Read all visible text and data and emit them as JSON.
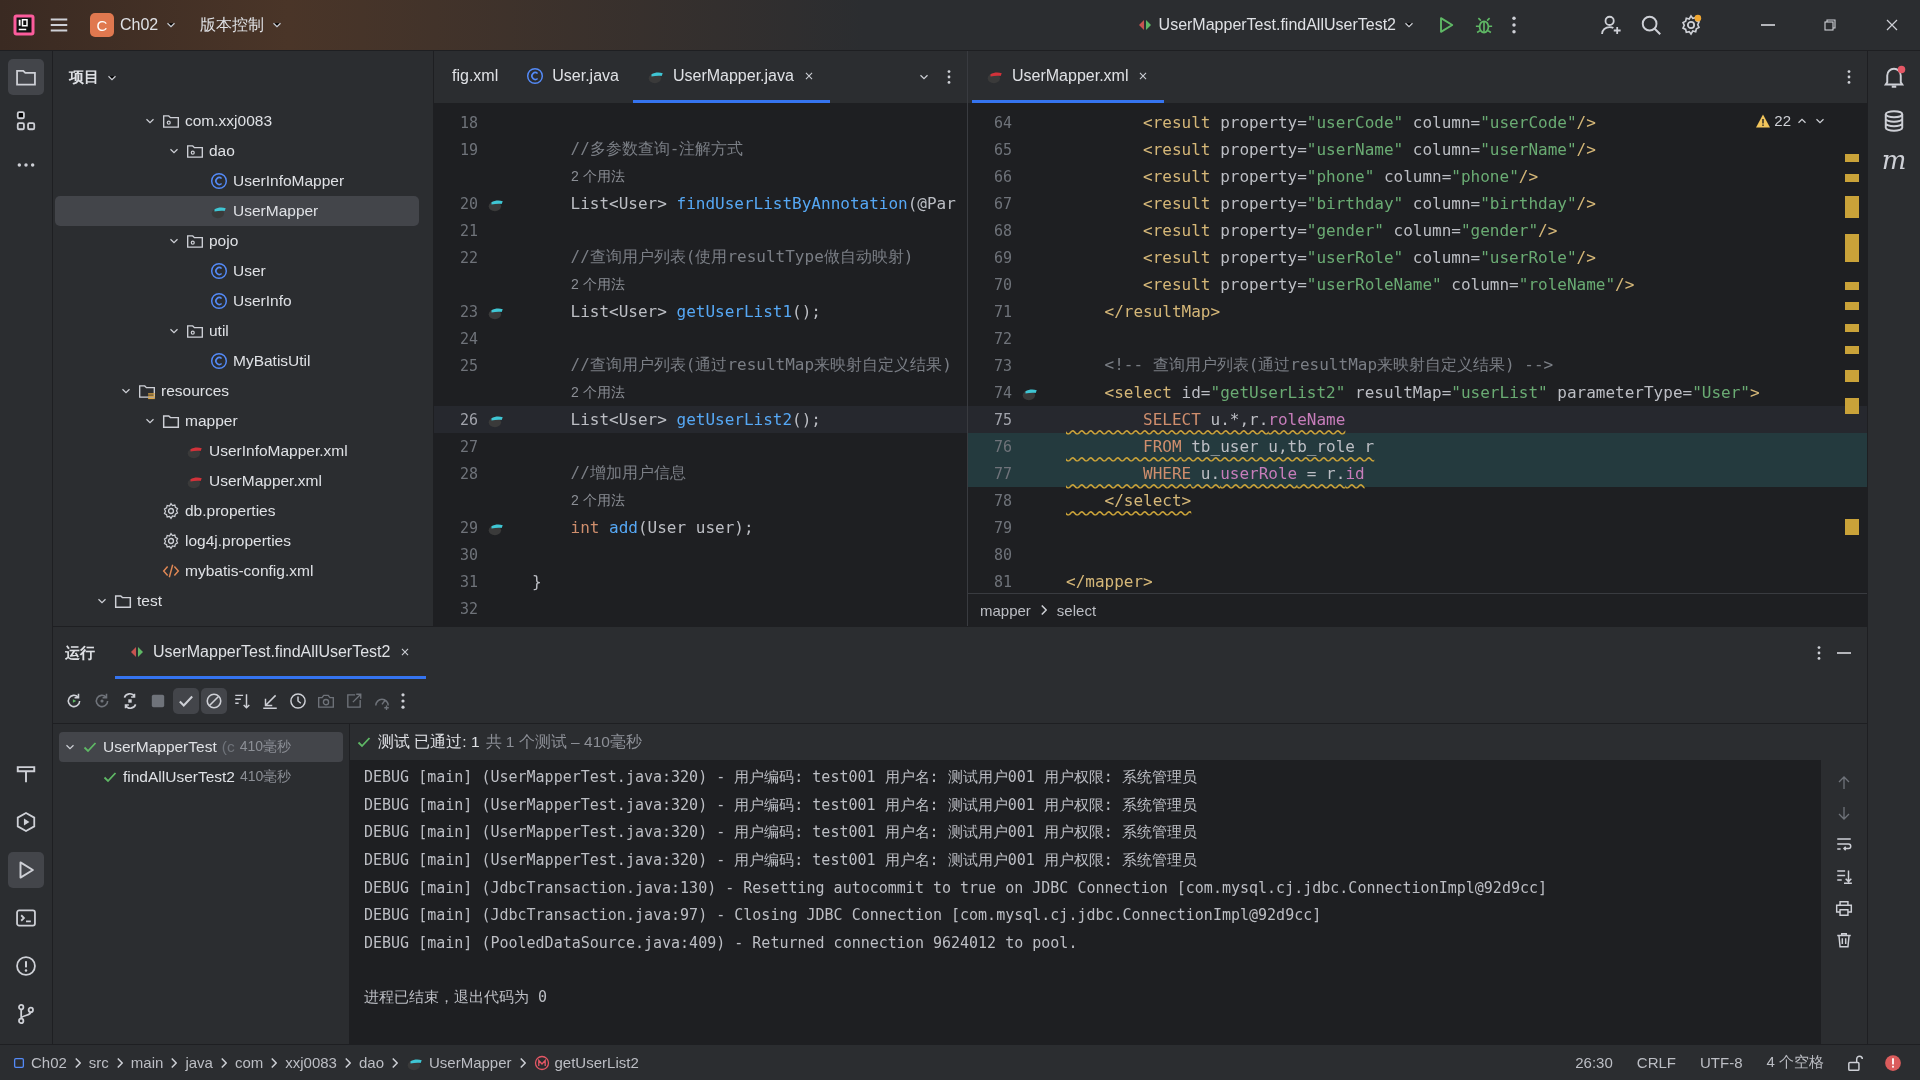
{
  "title_bar": {
    "project": {
      "badge": "C",
      "name": "Ch02"
    },
    "vcs": "版本控制",
    "run_config": "UserMapperTest.findAllUserTest2"
  },
  "left_toolbar": {
    "top": [
      {
        "kind": "folder",
        "selected": true
      },
      {
        "kind": "structure",
        "selected": false
      },
      {
        "kind": "more",
        "selected": false
      }
    ],
    "bottom": [
      {
        "kind": "hammer",
        "selected": false
      },
      {
        "kind": "services",
        "selected": false
      },
      {
        "kind": "run",
        "selected": true
      },
      {
        "kind": "terminal",
        "selected": false
      },
      {
        "kind": "problems",
        "selected": false
      },
      {
        "kind": "git",
        "selected": false
      }
    ]
  },
  "right_toolbar": [
    {
      "kind": "notifications"
    },
    {
      "kind": "database"
    },
    {
      "kind": "maven",
      "glyph": "m"
    }
  ],
  "project_panel": {
    "title": "项目",
    "tree": [
      {
        "children": [
          {
            "children": [
              {
                "label": "com.xxj0083",
                "kind": "package",
                "expanded": true,
                "selected": false,
                "children": [
                  {
                    "label": "dao",
                    "kind": "package",
                    "expanded": true,
                    "selected": false,
                    "children": [
                      {
                        "label": "UserInfoMapper",
                        "kind": "class",
                        "selected": false
                      },
                      {
                        "label": "UserMapper",
                        "kind": "mapper",
                        "selected": true
                      }
                    ]
                  },
                  {
                    "label": "pojo",
                    "kind": "package",
                    "expanded": true,
                    "selected": false,
                    "children": [
                      {
                        "label": "User",
                        "kind": "class",
                        "selected": false
                      },
                      {
                        "label": "UserInfo",
                        "kind": "class",
                        "selected": false
                      }
                    ]
                  },
                  {
                    "label": "util",
                    "kind": "package",
                    "expanded": true,
                    "selected": false,
                    "children": [
                      {
                        "label": "MyBatisUtil",
                        "kind": "class",
                        "selected": false
                      }
                    ]
                  }
                ]
              }
            ]
          },
          {
            "label": "resources",
            "kind": "resources",
            "expanded": true,
            "selected": false,
            "children": [
              {
                "label": "mapper",
                "kind": "folder",
                "expanded": true,
                "selected": false,
                "children": [
                  {
                    "label": "UserInfoMapper.xml",
                    "kind": "mapper_xml",
                    "selected": false
                  },
                  {
                    "label": "UserMapper.xml",
                    "kind": "mapper_xml",
                    "selected": false
                  }
                ]
              },
              {
                "label": "db.properties",
                "kind": "properties",
                "selected": false
              },
              {
                "label": "log4j.properties",
                "kind": "properties",
                "selected": false
              },
              {
                "label": "mybatis-config.xml",
                "kind": "xml",
                "selected": false
              }
            ]
          }
        ]
      },
      {
        "label": "test",
        "kind": "folder",
        "expanded": true,
        "selected": false
      }
    ]
  },
  "left_editor": {
    "tabs": [
      {
        "label": "fig.xml",
        "kind": "plain",
        "selected": false
      },
      {
        "label": "User.java",
        "kind": "class",
        "selected": false
      },
      {
        "label": "UserMapper.java",
        "kind": "mapper",
        "selected": true,
        "closable": true
      }
    ],
    "lines": [
      {
        "kind": "code",
        "number": "18",
        "current": false,
        "marker": false
      },
      {
        "kind": "code",
        "number": "19",
        "current": false,
        "marker": false,
        "tokens": [
          {
            "kind": "comment",
            "text": "    //多参数查询-注解方式"
          }
        ]
      },
      {
        "kind": "hint",
        "text": "2 个用法"
      },
      {
        "kind": "code",
        "number": "20",
        "current": false,
        "marker": true,
        "tokens": [
          {
            "kind": "plain",
            "text": "    List<User> "
          },
          {
            "kind": "method",
            "text": "findUserListByAnnotation"
          },
          {
            "kind": "plain",
            "text": "(@Par"
          }
        ]
      },
      {
        "kind": "code",
        "number": "21",
        "current": false,
        "marker": false
      },
      {
        "kind": "code",
        "number": "22",
        "current": false,
        "marker": false,
        "tokens": [
          {
            "kind": "comment",
            "text": "    //查询用户列表(使用resultType做自动映射)"
          }
        ]
      },
      {
        "kind": "hint",
        "text": "2 个用法"
      },
      {
        "kind": "code",
        "number": "23",
        "current": false,
        "marker": true,
        "tokens": [
          {
            "kind": "plain",
            "text": "    List<User> "
          },
          {
            "kind": "method",
            "text": "getUserList1"
          },
          {
            "kind": "plain",
            "text": "();"
          }
        ]
      },
      {
        "kind": "code",
        "number": "24",
        "current": false,
        "marker": false
      },
      {
        "kind": "code",
        "number": "25",
        "current": false,
        "marker": false,
        "tokens": [
          {
            "kind": "comment",
            "text": "    //查询用户列表(通过resultMap来映射自定义结果)"
          }
        ]
      },
      {
        "kind": "hint",
        "text": "2 个用法"
      },
      {
        "kind": "code",
        "number": "26",
        "current": true,
        "marker": true,
        "tokens": [
          {
            "kind": "plain",
            "text": "    List<User> "
          },
          {
            "kind": "method",
            "text": "getUserList2"
          },
          {
            "kind": "plain",
            "text": "();"
          }
        ]
      },
      {
        "kind": "code",
        "number": "27",
        "current": false,
        "marker": false
      },
      {
        "kind": "code",
        "number": "28",
        "current": false,
        "marker": false,
        "tokens": [
          {
            "kind": "comment",
            "text": "    //增加用户信息"
          }
        ]
      },
      {
        "kind": "hint",
        "text": "2 个用法"
      },
      {
        "kind": "code",
        "number": "29",
        "current": false,
        "marker": true,
        "tokens": [
          {
            "kind": "keyword",
            "text": "    int "
          },
          {
            "kind": "method",
            "text": "add"
          },
          {
            "kind": "plain",
            "text": "(User user);"
          }
        ]
      },
      {
        "kind": "code",
        "number": "30",
        "current": false,
        "marker": false
      },
      {
        "kind": "code",
        "number": "31",
        "current": false,
        "marker": false,
        "tokens": [
          {
            "kind": "plain",
            "text": "}"
          }
        ]
      },
      {
        "kind": "code",
        "number": "32",
        "current": false,
        "marker": false
      }
    ]
  },
  "right_editor": {
    "tabs": [
      {
        "label": "UserMapper.xml",
        "kind": "mapper_xml",
        "selected": true,
        "closable": true
      }
    ],
    "warnings": "22",
    "lines": [
      {
        "number": "64",
        "current": false,
        "highlighted": false,
        "warning": false,
        "marker": false,
        "tokens": [
          {
            "kind": "tag",
            "text": "        <result"
          },
          {
            "kind": "attr",
            "text": " property="
          },
          {
            "kind": "string",
            "text": "\"userCode\""
          },
          {
            "kind": "attr",
            "text": " column="
          },
          {
            "kind": "string",
            "text": "\"userCode\""
          },
          {
            "kind": "tag",
            "text": "/>"
          }
        ]
      },
      {
        "number": "65",
        "current": false,
        "highlighted": false,
        "warning": false,
        "marker": false,
        "tokens": [
          {
            "kind": "tag",
            "text": "        <result"
          },
          {
            "kind": "attr",
            "text": " property="
          },
          {
            "kind": "string",
            "text": "\"userName\""
          },
          {
            "kind": "attr",
            "text": " column="
          },
          {
            "kind": "string",
            "text": "\"userName\""
          },
          {
            "kind": "tag",
            "text": "/>"
          }
        ]
      },
      {
        "number": "66",
        "current": false,
        "highlighted": false,
        "warning": false,
        "marker": false,
        "tokens": [
          {
            "kind": "tag",
            "text": "        <result"
          },
          {
            "kind": "attr",
            "text": " property="
          },
          {
            "kind": "string",
            "text": "\"phone\""
          },
          {
            "kind": "attr",
            "text": " column="
          },
          {
            "kind": "string",
            "text": "\"phone\""
          },
          {
            "kind": "tag",
            "text": "/>"
          }
        ]
      },
      {
        "number": "67",
        "current": false,
        "highlighted": false,
        "warning": false,
        "marker": false,
        "tokens": [
          {
            "kind": "tag",
            "text": "        <result"
          },
          {
            "kind": "attr",
            "text": " property="
          },
          {
            "kind": "string",
            "text": "\"birthday\""
          },
          {
            "kind": "attr",
            "text": " column="
          },
          {
            "kind": "string",
            "text": "\"birthday\""
          },
          {
            "kind": "tag",
            "text": "/>"
          }
        ]
      },
      {
        "number": "68",
        "current": false,
        "highlighted": false,
        "warning": false,
        "marker": false,
        "tokens": [
          {
            "kind": "tag",
            "text": "        <result"
          },
          {
            "kind": "attr",
            "text": " property="
          },
          {
            "kind": "string",
            "text": "\"gender\""
          },
          {
            "kind": "attr",
            "text": " column="
          },
          {
            "kind": "string",
            "text": "\"gender\""
          },
          {
            "kind": "tag",
            "text": "/>"
          }
        ]
      },
      {
        "number": "69",
        "current": false,
        "highlighted": false,
        "warning": false,
        "marker": false,
        "tokens": [
          {
            "kind": "tag",
            "text": "        <result"
          },
          {
            "kind": "attr",
            "text": " property="
          },
          {
            "kind": "string",
            "text": "\"userRole\""
          },
          {
            "kind": "attr",
            "text": " column="
          },
          {
            "kind": "string",
            "text": "\"userRole\""
          },
          {
            "kind": "tag",
            "text": "/>"
          }
        ]
      },
      {
        "number": "70",
        "current": false,
        "highlighted": false,
        "warning": false,
        "marker": false,
        "tokens": [
          {
            "kind": "tag",
            "text": "        <result"
          },
          {
            "kind": "attr",
            "text": " property="
          },
          {
            "kind": "string",
            "text": "\"userRoleName\""
          },
          {
            "kind": "attr",
            "text": " column="
          },
          {
            "kind": "string",
            "text": "\"roleName\""
          },
          {
            "kind": "tag",
            "text": "/>"
          }
        ]
      },
      {
        "number": "71",
        "current": false,
        "highlighted": false,
        "warning": false,
        "marker": false,
        "tokens": [
          {
            "kind": "tag",
            "text": "    </resultMap>"
          }
        ]
      },
      {
        "number": "72",
        "current": false,
        "highlighted": false,
        "marker": false
      },
      {
        "number": "73",
        "current": false,
        "highlighted": false,
        "warning": false,
        "marker": false,
        "tokens": [
          {
            "kind": "comment",
            "text": "    <!-- 查询用户列表(通过resultMap来映射自定义结果) -->"
          }
        ]
      },
      {
        "number": "74",
        "current": false,
        "highlighted": false,
        "warning": false,
        "marker": true,
        "tokens": [
          {
            "kind": "tag",
            "text": "    <select"
          },
          {
            "kind": "attr",
            "text": " id="
          },
          {
            "kind": "string",
            "text": "\"getUserList2\""
          },
          {
            "kind": "attr",
            "text": " resultMap="
          },
          {
            "kind": "string",
            "text": "\"userList\""
          },
          {
            "kind": "attr",
            "text": " parameterType="
          },
          {
            "kind": "string",
            "text": "\"User\""
          },
          {
            "kind": "tag",
            "text": ">"
          }
        ]
      },
      {
        "number": "75",
        "current": true,
        "highlighted": false,
        "warning": true,
        "marker": false,
        "tokens": [
          {
            "kind": "sql_keyword",
            "text": "        SELECT"
          },
          {
            "kind": "plain",
            "text": " u.*,r."
          },
          {
            "kind": "column",
            "text": "roleName"
          }
        ]
      },
      {
        "number": "76",
        "current": false,
        "highlighted": true,
        "warning": true,
        "marker": false,
        "tokens": [
          {
            "kind": "sql_keyword",
            "text": "        FROM"
          },
          {
            "kind": "plain",
            "text": " tb_user u,tb_role r"
          }
        ]
      },
      {
        "number": "77",
        "current": false,
        "highlighted": true,
        "warning": true,
        "marker": false,
        "tokens": [
          {
            "kind": "sql_keyword",
            "text": "        WHERE"
          },
          {
            "kind": "plain",
            "text": " u."
          },
          {
            "kind": "column",
            "text": "userRole"
          },
          {
            "kind": "plain",
            "text": " = r."
          },
          {
            "kind": "column",
            "text": "id"
          }
        ]
      },
      {
        "number": "78",
        "current": false,
        "highlighted": false,
        "warning": true,
        "marker": false,
        "tokens": [
          {
            "kind": "tag",
            "text": "    </select>"
          }
        ]
      },
      {
        "number": "79",
        "current": false,
        "highlighted": false,
        "marker": false
      },
      {
        "number": "80",
        "current": false,
        "highlighted": false,
        "marker": false
      },
      {
        "number": "81",
        "current": false,
        "highlighted": false,
        "warning": false,
        "marker": false,
        "tokens": [
          {
            "kind": "tag",
            "text": "</mapper>"
          }
        ]
      }
    ],
    "breadcrumbs": [
      "mapper",
      "select"
    ]
  },
  "run_panel": {
    "title": "运行",
    "tabs": [
      {
        "label": "UserMapperTest.findAllUserTest2",
        "selected": true
      }
    ],
    "toolbar": [
      {
        "kind": "rerun",
        "disabled": false,
        "on": false
      },
      {
        "kind": "rerun_failed",
        "disabled": true,
        "on": false
      },
      {
        "kind": "toggle_auto",
        "disabled": false,
        "on": false
      },
      {
        "kind": "stop",
        "disabled": true,
        "on": false
      },
      {
        "kind": "show_passed",
        "disabled": false,
        "on": true
      },
      {
        "kind": "show_ignored",
        "disabled": false,
        "on": true
      },
      {
        "kind": "sort",
        "disabled": false,
        "on": false
      },
      {
        "kind": "import",
        "disabled": false,
        "on": false
      },
      {
        "kind": "history",
        "disabled": false,
        "on": false
      },
      {
        "kind": "camera",
        "disabled": true,
        "on": false
      },
      {
        "kind": "export",
        "disabled": true,
        "on": false
      },
      {
        "kind": "gauge",
        "disabled": true,
        "on": false
      },
      {
        "kind": "more",
        "disabled": false,
        "on": false
      }
    ],
    "tests": [
      {
        "label": "UserMapperTest",
        "detail": "(c",
        "time": "410毫秒",
        "passed": true,
        "expanded": true,
        "selected": true,
        "children": [
          {
            "label": "findAllUserTest2",
            "time": "410毫秒",
            "passed": true,
            "selected": false
          }
        ]
      }
    ],
    "summary": {
      "passed": true,
      "status": "测试 已通过: 1",
      "detail": "共 1 个测试 – 410毫秒"
    },
    "console": [
      "DEBUG [main] (UserMapperTest.java:320) - 用户编码: test001 用户名: 测试用户001 用户权限: 系统管理员",
      "DEBUG [main] (UserMapperTest.java:320) - 用户编码: test001 用户名: 测试用户001 用户权限: 系统管理员",
      "DEBUG [main] (UserMapperTest.java:320) - 用户编码: test001 用户名: 测试用户001 用户权限: 系统管理员",
      "DEBUG [main] (UserMapperTest.java:320) - 用户编码: test001 用户名: 测试用户001 用户权限: 系统管理员",
      "DEBUG [main] (JdbcTransaction.java:130) - Resetting autocommit to true on JDBC Connection [com.mysql.cj.jdbc.ConnectionImpl@92d9cc]",
      "DEBUG [main] (JdbcTransaction.java:97) - Closing JDBC Connection [com.mysql.cj.jdbc.ConnectionImpl@92d9cc]",
      "DEBUG [main] (PooledDataSource.java:409) - Returned connection 9624012 to pool."
    ],
    "exit_message": "进程已结束，退出代码为 0",
    "side_toolbar": [
      {
        "kind": "up",
        "disabled": true
      },
      {
        "kind": "down",
        "disabled": true
      },
      {
        "kind": "wrap",
        "disabled": false
      },
      {
        "kind": "scroll_end",
        "disabled": false
      },
      {
        "kind": "print",
        "disabled": false
      },
      {
        "kind": "trash",
        "disabled": false
      }
    ]
  },
  "status_bar": {
    "path": [
      {
        "label": "Ch02",
        "kind": "module"
      },
      {
        "label": "src",
        "kind": "plain"
      },
      {
        "label": "main",
        "kind": "plain"
      },
      {
        "label": "java",
        "kind": "plain"
      },
      {
        "label": "com",
        "kind": "plain"
      },
      {
        "label": "xxj0083",
        "kind": "plain"
      },
      {
        "label": "dao",
        "kind": "plain"
      },
      {
        "label": "UserMapper",
        "kind": "mapper"
      },
      {
        "label": "getUserList2",
        "kind": "method"
      }
    ],
    "position": "26:30",
    "line_ending": "CRLF",
    "encoding": "UTF-8",
    "indent": "4 个空格"
  }
}
